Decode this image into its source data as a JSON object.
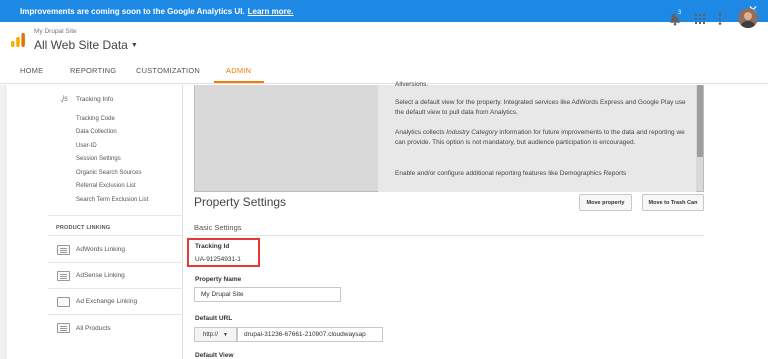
{
  "banner": {
    "message": "Improvements are coming soon to the Google Analytics UI.",
    "link": "Learn more.",
    "close_glyph": "✕"
  },
  "header": {
    "account_name": "My Drupal Site",
    "property_name": "All Web Site Data",
    "notification_count": "3",
    "icons": [
      "analytics-logo-icon",
      "bell-icon",
      "apps-grid-icon",
      "more-vert-icon",
      "avatar"
    ]
  },
  "tabs": [
    "HOME",
    "REPORTING",
    "CUSTOMIZATION",
    "ADMIN"
  ],
  "active_tab": "ADMIN",
  "sidebar": {
    "tracking_info": {
      "icon_text": ".js",
      "label": "Tracking Info"
    },
    "tracking_sub": [
      "Tracking Code",
      "Data Collection",
      "User-ID",
      "Session Settings",
      "Organic Search Sources",
      "Referral Exclusion List",
      "Search Term Exclusion List"
    ],
    "product_linking_heading": "PRODUCT LINKING",
    "linking_items": [
      "AdWords Linking",
      "AdSense Linking",
      "Ad Exchange Linking",
      "All Products"
    ]
  },
  "info_panel": {
    "line_top": "Allversions.",
    "p1": "Select a default view for the property. Integrated services like AdWords Express and Google Play use the default view to pull data from Analytics.",
    "p2_before": "Analytics collects ",
    "p2_em": "Industry Category",
    "p2_after": " information for future improvements to the data and reporting we can provide. This option is not mandatory, but audience participation is encouraged.",
    "p3": "Enable and/or configure additional reporting features like Demographics Reports"
  },
  "property_settings": {
    "title": "Property Settings",
    "move_property": "Move property",
    "move_to_trash": "Move to Trash Can",
    "basic_settings": "Basic Settings",
    "tracking_id_label": "Tracking Id",
    "tracking_id_value": "UA-91254931-1",
    "property_name_label": "Property Name",
    "property_name_value": "My Drupal Site",
    "default_url_label": "Default URL",
    "protocol": "http://",
    "default_url_value": "drupal-31236-67661-210907.cloudwaysap",
    "default_view_label": "Default View"
  },
  "colors": {
    "banner": "#1e88e5",
    "accent": "#f57c00",
    "highlight_border": "#e53935"
  }
}
